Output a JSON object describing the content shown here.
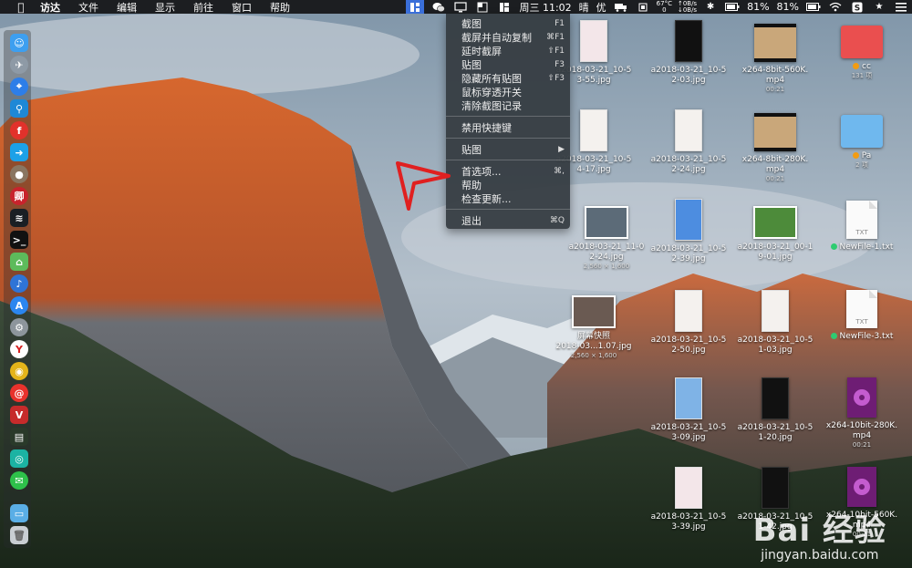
{
  "menubar": {
    "app_name": "访达",
    "menus": [
      "文件",
      "编辑",
      "显示",
      "前往",
      "窗口",
      "帮助"
    ],
    "cpu_temp": "67°C",
    "cpu_load": "0",
    "net_up": "↑0B/s",
    "net_down": "↓0B/s",
    "datetime": "周三 11:02",
    "weather": "晴",
    "power": "优",
    "battery_1": "81%",
    "battery_2": "81%"
  },
  "dropdown": {
    "items": [
      {
        "label": "截图",
        "shortcut": "F1"
      },
      {
        "label": "截屏并自动复制",
        "shortcut": "⌘F1"
      },
      {
        "label": "延时截屏",
        "shortcut": "⇧F1"
      },
      {
        "label": "贴图",
        "shortcut": "F3"
      },
      {
        "label": "隐藏所有贴图",
        "shortcut": "⇧F3"
      },
      {
        "label": "鼠标穿透开关",
        "shortcut": ""
      },
      {
        "label": "清除截图记录",
        "shortcut": ""
      },
      {
        "label": "禁用快捷键",
        "shortcut": ""
      },
      {
        "label": "贴图",
        "shortcut": "▶"
      },
      {
        "label": "首选项...",
        "shortcut": "⌘,"
      },
      {
        "label": "帮助",
        "shortcut": ""
      },
      {
        "label": "检查更新...",
        "shortcut": ""
      },
      {
        "label": "退出",
        "shortcut": "⌘Q"
      }
    ]
  },
  "desktop": {
    "icons": [
      {
        "name": "a2018-03-21_10-5\n3-55.jpg",
        "line1": "a2018-03-21_10-5",
        "line2": "3-55.jpg",
        "sub": ""
      },
      {
        "name": "a2018-03-21_10-5\n2-03.jpg",
        "line1": "a2018-03-21_10-5",
        "line2": "2-03.jpg",
        "sub": ""
      },
      {
        "name": "x264-8bit-560K.mp4",
        "line1": "x264-8bit-560K.",
        "line2": "mp4",
        "sub": "00:21"
      },
      {
        "name": "cc",
        "line1": "cc",
        "line2": "",
        "sub": "131 项"
      },
      {
        "name": "a2018-03-21_10-5\n4-17.jpg",
        "line1": "a2018-03-21_10-5",
        "line2": "4-17.jpg",
        "sub": ""
      },
      {
        "name": "a2018-03-21_10-5\n2-24.jpg",
        "line1": "a2018-03-21_10-5",
        "line2": "2-24.jpg",
        "sub": ""
      },
      {
        "name": "x264-8bit-280K.mp4",
        "line1": "x264-8bit-280K.",
        "line2": "mp4",
        "sub": "00:21"
      },
      {
        "name": "Pa",
        "line1": "Pa",
        "line2": "",
        "sub": "2 项"
      },
      {
        "name": "a2018-03-21_11-0\n2-24.jpg",
        "line1": "a2018-03-21_11-0",
        "line2": "2-24.jpg",
        "sub": "2,560 × 1,600"
      },
      {
        "name": "a2018-03-21_10-5\n2-39.jpg",
        "line1": "a2018-03-21_10-5",
        "line2": "2-39.jpg",
        "sub": ""
      },
      {
        "name": "a2018-03-21_00-1\n9-01.jpg",
        "line1": "a2018-03-21_00-1",
        "line2": "9-01.jpg",
        "sub": ""
      },
      {
        "name": "NewFile-1.txt",
        "line1": "NewFile-1.txt",
        "line2": "",
        "sub": ""
      },
      {
        "name": "屏幕快照\n2018-03...1.07.jpg",
        "line1": "屏幕快照",
        "line2": "2018-03...1.07.jpg",
        "sub": "2,560 × 1,600"
      },
      {
        "name": "a2018-03-21_10-5\n2-50.jpg",
        "line1": "a2018-03-21_10-5",
        "line2": "2-50.jpg",
        "sub": ""
      },
      {
        "name": "a2018-03-21_10-5\n1-03.jpg",
        "line1": "a2018-03-21_10-5",
        "line2": "1-03.jpg",
        "sub": ""
      },
      {
        "name": "NewFile-3.txt",
        "line1": "NewFile-3.txt",
        "line2": "",
        "sub": ""
      },
      {
        "name": "a2018-03-21_10-5\n3-09.jpg",
        "line1": "a2018-03-21_10-5",
        "line2": "3-09.jpg",
        "sub": ""
      },
      {
        "name": "a2018-03-21_10-5\n1-20.jpg",
        "line1": "a2018-03-21_10-5",
        "line2": "1-20.jpg",
        "sub": ""
      },
      {
        "name": "x264-10bit-280K.mp4",
        "line1": "x264-10bit-280K.",
        "line2": "mp4",
        "sub": "00:21"
      },
      {
        "name": "a2018-03-21_10-5\n3-39.jpg",
        "line1": "a2018-03-21_10-5",
        "line2": "3-39.jpg",
        "sub": ""
      },
      {
        "name": "a2018-03-21_10-5\n1-42.jpg",
        "line1": "a2018-03-21_10-5",
        "line2": "1-42.jpg",
        "sub": ""
      },
      {
        "name": "x264-10bit-560K.mp4",
        "line1": "x264-10bit-560K.",
        "line2": "mp4",
        "sub": "00:21"
      }
    ],
    "txt_label": "TXT"
  },
  "watermark": {
    "main": "Bai 经验",
    "sub": "jingyan.baidu.com"
  },
  "colors": {
    "accent": "#3a6fd9",
    "tag_orange": "#f39c12",
    "tag_green": "#2ecc71",
    "annotation_red": "#e02020"
  }
}
